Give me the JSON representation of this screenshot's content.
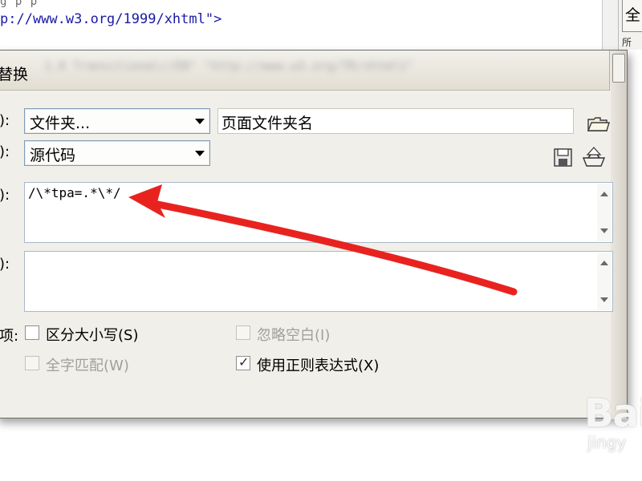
{
  "editor": {
    "line_partial": "g        p       p",
    "line": "p://www.w3.org/1999/xhtml\">",
    "title_blur": "1.0 Transitional//EN\" \"http://www.w3.org/TR/xhtml1\""
  },
  "right_panel": {
    "button_label": "全",
    "tab_label": "所"
  },
  "dialog": {
    "title": "替换",
    "find_in": {
      "label": "):",
      "value": "文件夹..."
    },
    "folder_path": {
      "value": "页面文件夹名"
    },
    "search_type": {
      "label": "):",
      "value": "源代码"
    },
    "find_text": {
      "label": "):",
      "value": "/\\*tpa=.*\\*/"
    },
    "replace_text": {
      "label": "):",
      "value": ""
    },
    "options_label": "项:",
    "options": {
      "case_sensitive": {
        "label": "区分大小写(S)",
        "checked": false,
        "enabled": true
      },
      "ignore_whitespace": {
        "label": "忽略空白(I)",
        "checked": false,
        "enabled": false
      },
      "whole_word": {
        "label": "全字匹配(W)",
        "checked": false,
        "enabled": false
      },
      "use_regex": {
        "label": "使用正则表达式(X)",
        "checked": true,
        "enabled": true
      }
    }
  },
  "annotation": {
    "arrow_color": "#e8231f"
  },
  "watermark": {
    "text": "Bai",
    "sub": "jingy"
  }
}
